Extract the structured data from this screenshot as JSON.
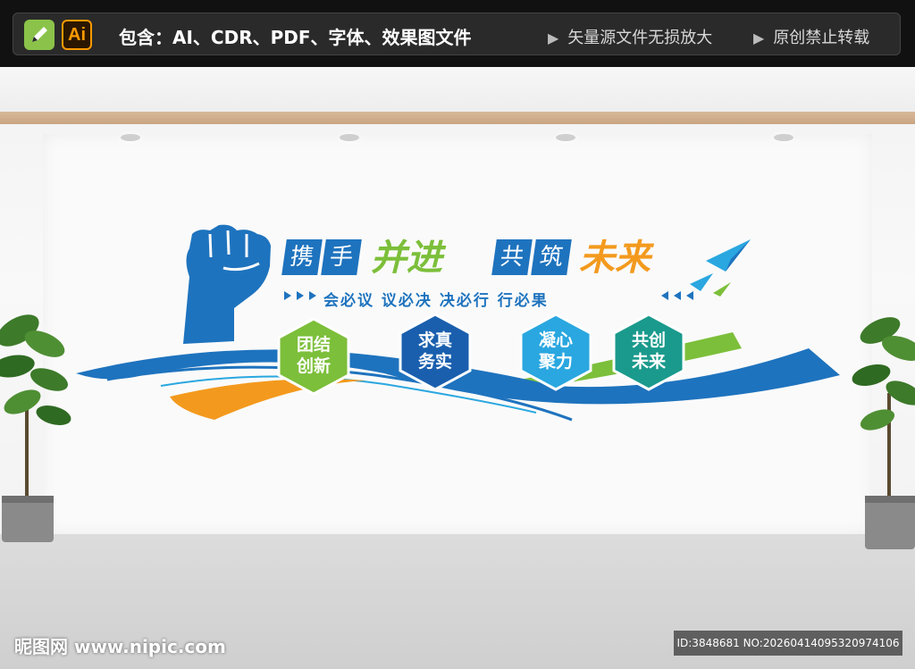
{
  "banner": {
    "icon_left": "pen-icon",
    "icon_ai_label": "Ai",
    "includes_text": "包含：AI、CDR、PDF、字体、效果图文件",
    "right_text_1": "矢量源文件无损放大",
    "right_text_2": "原创禁止转载"
  },
  "headline": {
    "char1": "携",
    "char2": "手",
    "big1": "并进",
    "char3": "共",
    "char4": "筑",
    "big2": "未来"
  },
  "subline": "会必议  议必决  决必行  行必果",
  "values": [
    {
      "line1": "团结",
      "line2": "创新",
      "color": "#7cbf3a"
    },
    {
      "line1": "求真",
      "line2": "务实",
      "color": "#1a5fae"
    },
    {
      "line1": "凝心",
      "line2": "聚力",
      "color": "#2aa7e0"
    },
    {
      "line1": "共创",
      "line2": "未来",
      "color": "#1a9a8c"
    }
  ],
  "colors": {
    "blue": "#1e73be",
    "green": "#7cbf3a",
    "orange": "#f39a1e"
  },
  "watermark": "昵图网 www.nipic.com",
  "image_id": "ID:3848681 NO:20260414095320974106"
}
